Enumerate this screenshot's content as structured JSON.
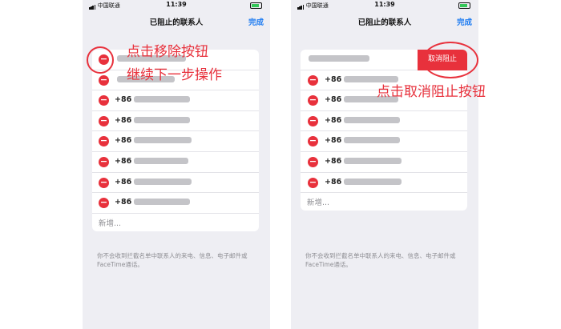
{
  "status_bar": {
    "carrier": "中国联通",
    "time": "11:39"
  },
  "left_phone": {
    "nav_title": "已阻止的联系人",
    "done_label": "完成",
    "rows": [
      {
        "prefix": ""
      },
      {
        "prefix": ""
      },
      {
        "prefix": "+86"
      },
      {
        "prefix": "+86"
      },
      {
        "prefix": "+86"
      },
      {
        "prefix": "+86"
      },
      {
        "prefix": "+86"
      },
      {
        "prefix": "+86"
      }
    ],
    "add_label": "新增...",
    "footer": "你不会收到拦截名单中联系人的来电、信息、电子邮件或FaceTime通话。"
  },
  "right_phone": {
    "nav_title": "已阻止的联系人",
    "done_label": "完成",
    "unblock_label": "取消阻止",
    "rows": [
      {
        "prefix": ""
      },
      {
        "prefix": "+86"
      },
      {
        "prefix": "+86"
      },
      {
        "prefix": "+86"
      },
      {
        "prefix": "+86"
      },
      {
        "prefix": "+86"
      },
      {
        "prefix": "+86"
      }
    ],
    "add_label": "新增...",
    "footer": "你不会收到拦截名单中联系人的来电、信息、电子邮件或FaceTime通话。"
  },
  "annotations": {
    "left_line1": "点击移除按钮",
    "left_line2": "继续下一步操作",
    "right": "点击取消阻止按钮"
  },
  "colors": {
    "accent_red": "#e8313c",
    "link_blue": "#1e7cf2"
  }
}
